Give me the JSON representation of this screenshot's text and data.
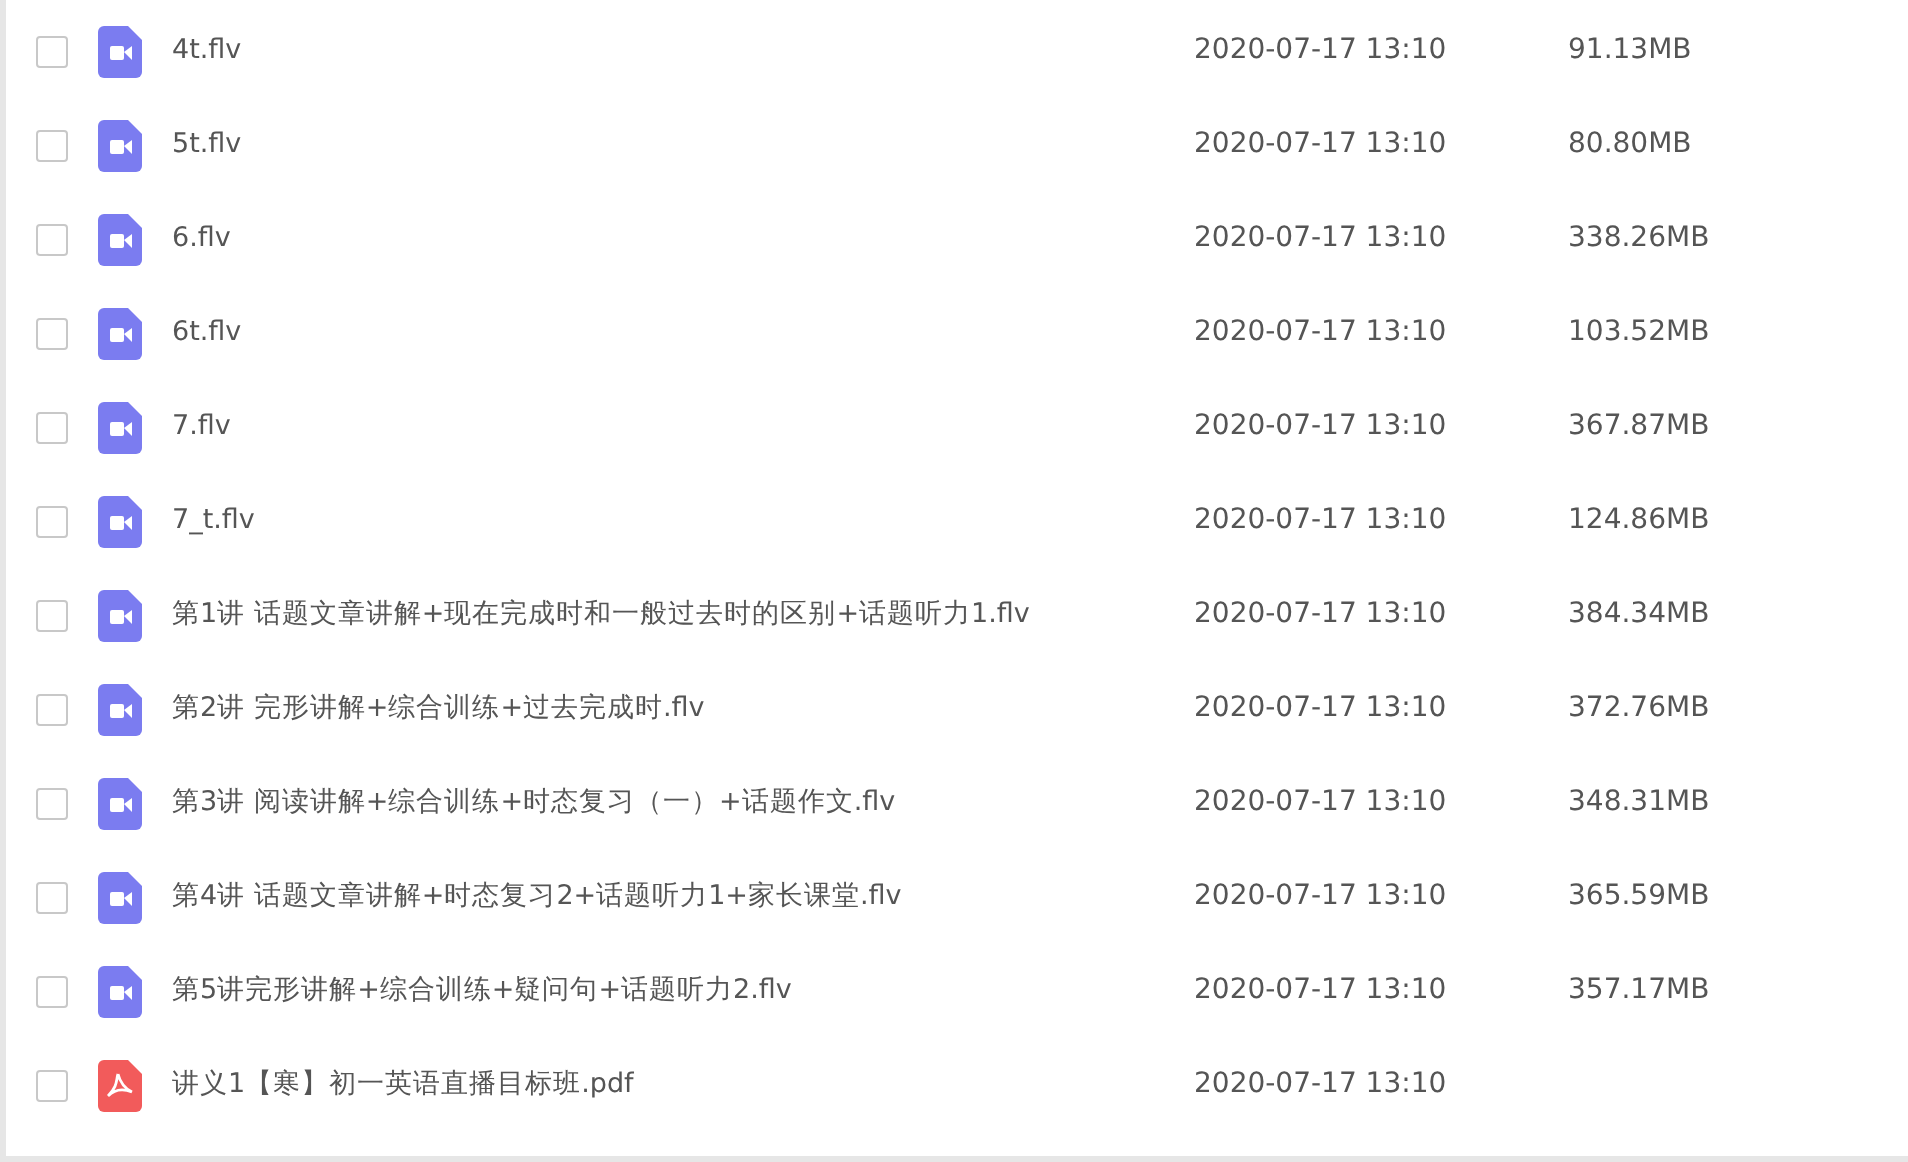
{
  "files": [
    {
      "kind": "video",
      "name": "4t.flv",
      "modified": "2020-07-17 13:10",
      "size": "91.13MB",
      "checked": false
    },
    {
      "kind": "video",
      "name": "5t.flv",
      "modified": "2020-07-17 13:10",
      "size": "80.80MB",
      "checked": false
    },
    {
      "kind": "video",
      "name": "6.flv",
      "modified": "2020-07-17 13:10",
      "size": "338.26MB",
      "checked": false
    },
    {
      "kind": "video",
      "name": "6t.flv",
      "modified": "2020-07-17 13:10",
      "size": "103.52MB",
      "checked": false
    },
    {
      "kind": "video",
      "name": "7.flv",
      "modified": "2020-07-17 13:10",
      "size": "367.87MB",
      "checked": false
    },
    {
      "kind": "video",
      "name": "7_t.flv",
      "modified": "2020-07-17 13:10",
      "size": "124.86MB",
      "checked": false
    },
    {
      "kind": "video",
      "name": "第1讲 话题文章讲解+现在完成时和一般过去时的区别+话题听力1.flv",
      "modified": "2020-07-17 13:10",
      "size": "384.34MB",
      "checked": false
    },
    {
      "kind": "video",
      "name": "第2讲 完形讲解+综合训练+过去完成时.flv",
      "modified": "2020-07-17 13:10",
      "size": "372.76MB",
      "checked": false
    },
    {
      "kind": "video",
      "name": "第3讲 阅读讲解+综合训练+时态复习（一）+话题作文.flv",
      "modified": "2020-07-17 13:10",
      "size": "348.31MB",
      "checked": false
    },
    {
      "kind": "video",
      "name": "第4讲 话题文章讲解+时态复习2+话题听力1+家长课堂.flv",
      "modified": "2020-07-17 13:10",
      "size": "365.59MB",
      "checked": false
    },
    {
      "kind": "video",
      "name": "第5讲完形讲解+综合训练+疑问句+话题听力2.flv",
      "modified": "2020-07-17 13:10",
      "size": "357.17MB",
      "checked": false
    },
    {
      "kind": "pdf",
      "name": "讲义1【寒】初一英语直播目标班.pdf",
      "modified": "2020-07-17 13:10",
      "checked": false
    }
  ]
}
